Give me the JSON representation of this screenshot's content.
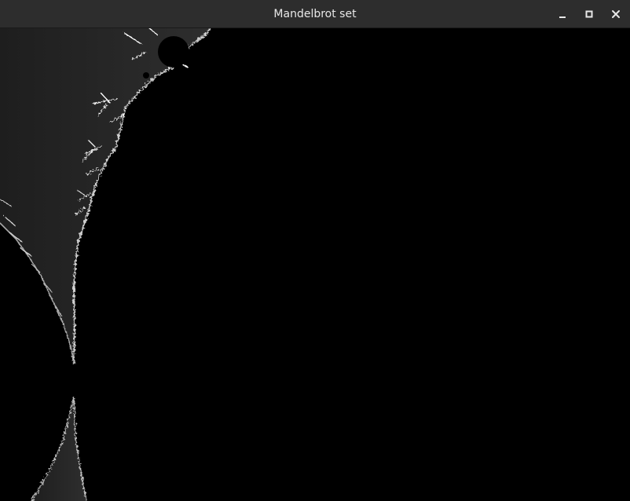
{
  "window": {
    "title": "Mandelbrot set",
    "controls": {
      "minimize_icon": "minimize-icon",
      "maximize_icon": "maximize-icon",
      "close_icon": "close-icon"
    }
  },
  "colors": {
    "titlebar": "#2d2d2d",
    "title_text": "#e8e8e8",
    "background": "#000000",
    "fractal_fill": "#262626",
    "fractal_edge": "#e0e0e0"
  },
  "canvas": {
    "icon": "mandelbrot-fractal-render"
  }
}
